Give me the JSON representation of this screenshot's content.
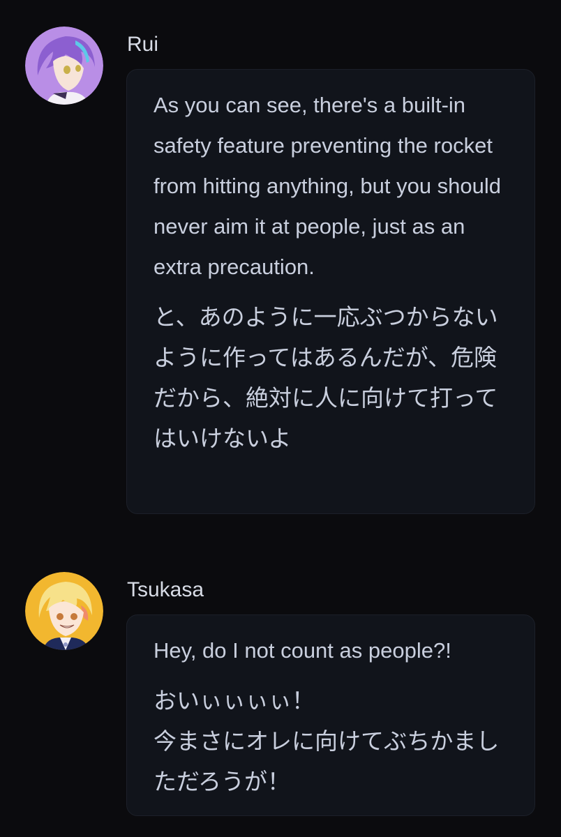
{
  "messages": [
    {
      "author": "Rui",
      "avatar_icon": "rui-avatar-icon",
      "avatar_bg": "#b98ee6",
      "english": "As you can see, there's a built-in safety feature preventing the rocket from hitting anything, but you should never aim it at people, just as an extra precaution.",
      "japanese": "と、あのように一応ぶつからないように作ってはあるんだが、危険だから、絶対に人に向けて打ってはいけないよ"
    },
    {
      "author": "Tsukasa",
      "avatar_icon": "tsukasa-avatar-icon",
      "avatar_bg": "#f2b72f",
      "english": "Hey, do I not count as people?!",
      "japanese": "おいぃぃぃぃ！\n今まさにオレに向けてぶちかましただろうが！"
    }
  ]
}
